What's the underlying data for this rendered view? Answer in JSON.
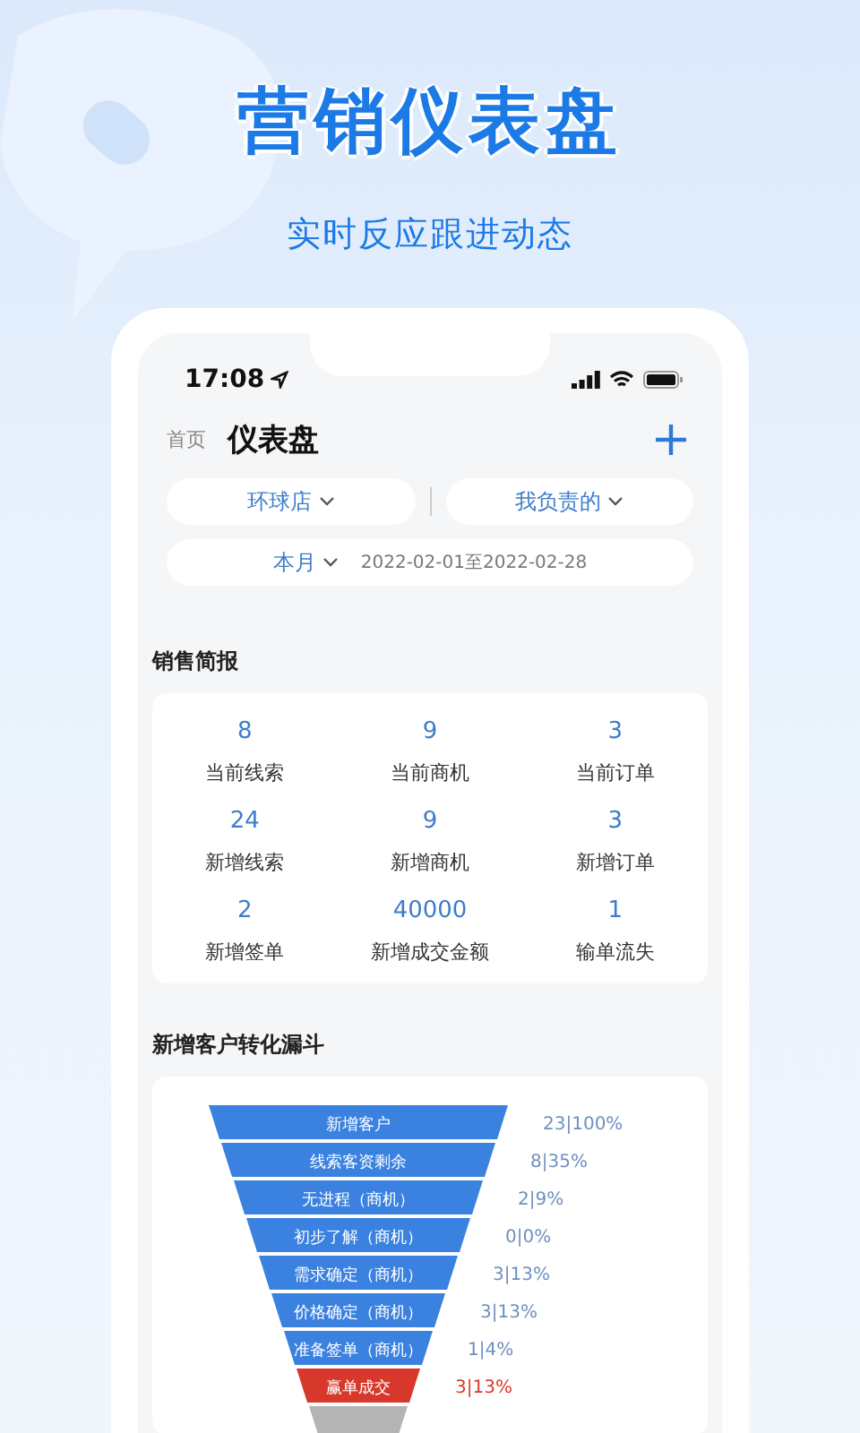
{
  "promo": {
    "title": "营销仪表盘",
    "subtitle": "实时反应跟进动态"
  },
  "status_bar": {
    "time": "17:08"
  },
  "nav": {
    "back": "首页",
    "title": "仪表盘"
  },
  "filters": [
    {
      "label": "环球店"
    },
    {
      "label": "我负责的"
    }
  ],
  "period": {
    "label": "本月",
    "range": "2022-02-01至2022-02-28"
  },
  "sales_summary": {
    "title": "销售简报",
    "stats": [
      {
        "value": "8",
        "label": "当前线索"
      },
      {
        "value": "9",
        "label": "当前商机"
      },
      {
        "value": "3",
        "label": "当前订单"
      },
      {
        "value": "24",
        "label": "新增线索"
      },
      {
        "value": "9",
        "label": "新增商机"
      },
      {
        "value": "3",
        "label": "新增订单"
      },
      {
        "value": "2",
        "label": "新增签单"
      },
      {
        "value": "40000",
        "label": "新增成交金额"
      },
      {
        "value": "1",
        "label": "输单流失"
      }
    ]
  },
  "funnel": {
    "title": "新增客户转化漏斗",
    "stages": [
      {
        "label": "新增客户",
        "value": "23|100%",
        "color": "#3b82e0"
      },
      {
        "label": "线索客资剩余",
        "value": "8|35%",
        "color": "#3b82e0"
      },
      {
        "label": "无进程（商机）",
        "value": "2|9%",
        "color": "#3b82e0"
      },
      {
        "label": "初步了解（商机）",
        "value": "0|0%",
        "color": "#3b82e0"
      },
      {
        "label": "需求确定（商机）",
        "value": "3|13%",
        "color": "#3b82e0"
      },
      {
        "label": "价格确定（商机）",
        "value": "3|13%",
        "color": "#3b82e0"
      },
      {
        "label": "准备签单（商机）",
        "value": "1|4%",
        "color": "#3b82e0"
      },
      {
        "label": "赢单成交",
        "value": "3|13%",
        "color": "#d8382c"
      }
    ],
    "truncated_stage": {
      "color": "#b4b4b4"
    }
  }
}
